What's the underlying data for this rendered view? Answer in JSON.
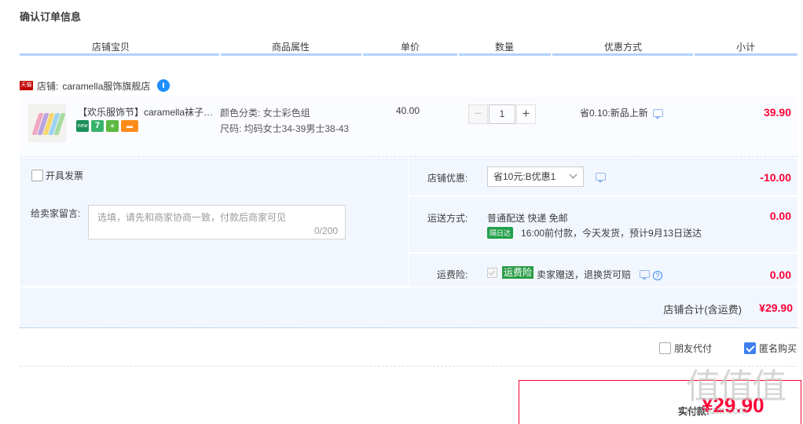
{
  "page_title": "确认订单信息",
  "columns": [
    "店铺宝贝",
    "商品属性",
    "单价",
    "数量",
    "优惠方式",
    "小计"
  ],
  "shop": {
    "badge": "天猫",
    "label": "店铺:",
    "name": "caramella服饰旗舰店"
  },
  "item": {
    "title": "【欢乐服饰节】caramella袜子…",
    "service_icons": [
      "new",
      "7",
      "☀",
      "▬"
    ],
    "prop_color": "颜色分类: 女士彩色组",
    "prop_size": "尺码: 均码女士34-39男士38-43",
    "unit_price": "40.00",
    "qty_minus": "−",
    "quantity": "1",
    "qty_plus": "+",
    "promo": "省0.10:新品上新",
    "subtotal": "39.90"
  },
  "invoice_label": "开具发票",
  "message": {
    "label": "给卖家留言:",
    "placeholder": "选填，请先和商家协商一致，付款后商家可见",
    "counter": "0/200"
  },
  "discount": {
    "label": "店铺优惠:",
    "selected": "省10元:B优惠1",
    "amount": "-10.00"
  },
  "shipping": {
    "label": "运送方式:",
    "method": "普通配送 快递 免邮",
    "badge": "隔日达",
    "note": "16:00前付款，今天发货，预计9月13日送达",
    "amount": "0.00"
  },
  "insurance": {
    "label": "运费险:",
    "badge": "运费险",
    "text": "卖家赠送，退换货可赔",
    "help": "?",
    "amount": "0.00"
  },
  "shop_total": {
    "label": "店铺合计(含运费)",
    "amount": "¥29.90"
  },
  "friend_pay": "朋友代付",
  "anonymous": "匿名购买",
  "actual_pay": {
    "label": "实付款:",
    "amount": "¥29.90"
  },
  "watermark": {
    "glyphs": "值值值",
    "url": "zhizhizm.com"
  },
  "colors": {
    "accent_red": "#ff0036",
    "header_line": "#b2d1ff",
    "panel_bg": "#f2f7ff",
    "check_blue": "#3d7ff0",
    "badge_green": "#2a9d47"
  }
}
